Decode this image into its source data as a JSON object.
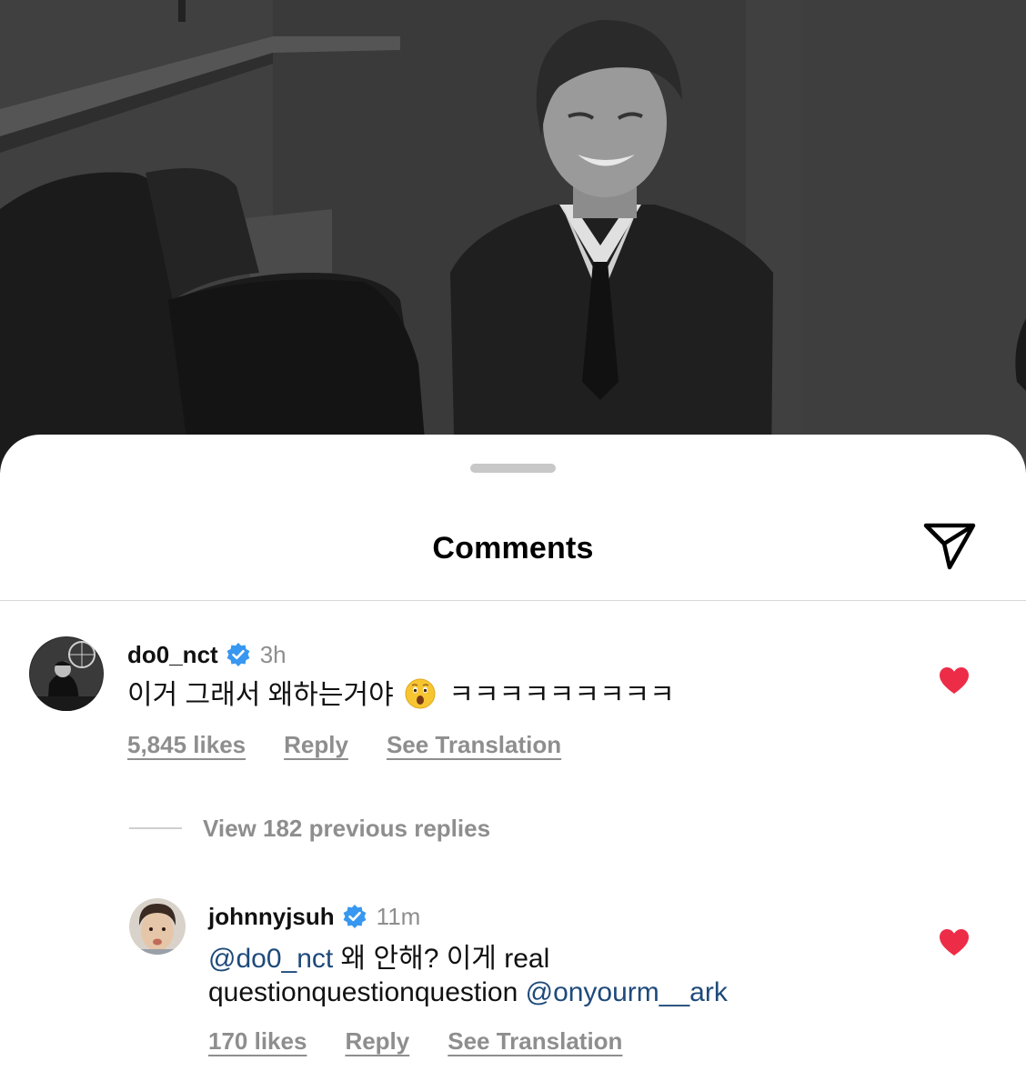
{
  "sheet": {
    "title": "Comments"
  },
  "comments": [
    {
      "username": "do0_nct",
      "time": "3h",
      "text_before_emoji": "이거 그래서 왜하는거야",
      "text_after_emoji": "ㅋㅋㅋㅋㅋㅋㅋㅋㅋ",
      "likes": "5,845 likes",
      "reply_label": "Reply",
      "translate_label": "See Translation",
      "liked": true
    }
  ],
  "view_replies": "View 182 previous replies",
  "replies": [
    {
      "username": "johnnyjsuh",
      "time": "11m",
      "mention1": "@do0_nct",
      "text_part1": " 왜 안해? 이게 real",
      "text_part2": "questionquestionquestion ",
      "mention2": "@onyourm__ark",
      "likes": "170 likes",
      "reply_label": "Reply",
      "translate_label": "See Translation",
      "liked": true
    }
  ],
  "icons": {
    "share": "paper-plane-icon",
    "verified": "verified-badge-icon",
    "heart": "heart-filled-icon",
    "emoji": "astonished-face-emoji"
  },
  "colors": {
    "heart": "#ed2d48",
    "verified": "#3897f0",
    "mention": "#1e4a7a",
    "secondary_text": "#8e8e8e"
  }
}
